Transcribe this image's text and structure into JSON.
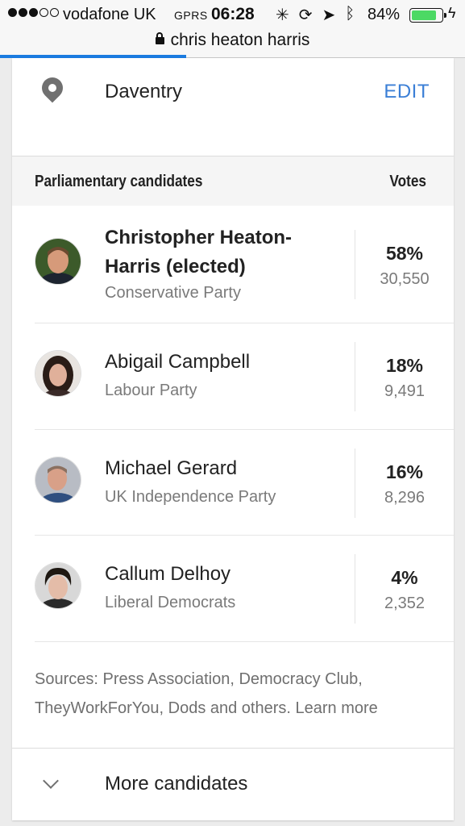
{
  "status_bar": {
    "carrier": "vodafone UK",
    "network": "GPRS",
    "time": "06:28",
    "battery_percent": "84%",
    "battery_level": 0.84,
    "signal_bars_filled": 3,
    "signal_bars_total": 5,
    "icons": [
      "activity-spinner-icon",
      "rotation-lock-icon",
      "location-arrow-icon",
      "bluetooth-icon",
      "charging-bolt-icon"
    ]
  },
  "url_bar": {
    "title": "chris heaton harris",
    "load_progress": 0.4
  },
  "location": {
    "icon": "map-pin-icon",
    "name": "Daventry",
    "edit_label": "EDIT"
  },
  "table_header": {
    "candidates_label": "Parliamentary candidates",
    "votes_label": "Votes"
  },
  "candidates": [
    {
      "name_line1": "Christopher Heaton-",
      "name_line2": "Harris (elected)",
      "party": "Conservative Party",
      "percent": "58%",
      "votes": "30,550"
    },
    {
      "name_line1": "Abigail Campbell",
      "party": "Labour Party",
      "percent": "18%",
      "votes": "9,491"
    },
    {
      "name_line1": "Michael Gerard",
      "party": "UK Independence Party",
      "percent": "16%",
      "votes": "8,296"
    },
    {
      "name_line1": "Callum Delhoy",
      "party": "Liberal Democrats",
      "percent": "4%",
      "votes": "2,352"
    }
  ],
  "sources": {
    "text": "Sources: Press Association, Democracy Club, TheyWorkForYou, Dods and others.",
    "learn_more": "Learn more"
  },
  "more_candidates": {
    "label": "More candidates",
    "icon": "chevron-down-icon"
  },
  "colors": {
    "link": "#3b7fd6",
    "progress": "#1a7be0",
    "battery": "#4cd964"
  }
}
